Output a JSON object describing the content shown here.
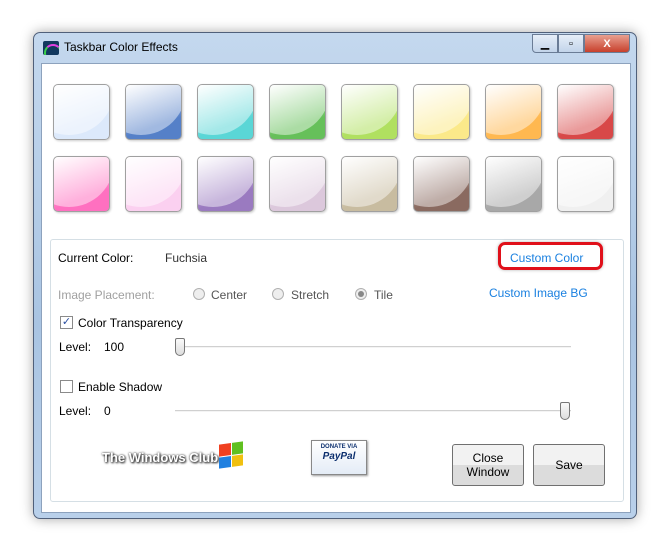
{
  "window": {
    "title": "Taskbar Color Effects",
    "close_glyph": "X"
  },
  "swatches": [
    {
      "name": "light-blue",
      "color": "#dce9fb"
    },
    {
      "name": "blue",
      "color": "#5580c8"
    },
    {
      "name": "cyan",
      "color": "#5ad6d6"
    },
    {
      "name": "green",
      "color": "#66c05a"
    },
    {
      "name": "lime",
      "color": "#b0e060"
    },
    {
      "name": "yellow",
      "color": "#fbe98a"
    },
    {
      "name": "orange",
      "color": "#ffb850"
    },
    {
      "name": "red",
      "color": "#d84848"
    },
    {
      "name": "fuchsia",
      "color": "#ff70c0"
    },
    {
      "name": "light-pink",
      "color": "#fbd0f0"
    },
    {
      "name": "purple",
      "color": "#9a7ac0"
    },
    {
      "name": "mauve",
      "color": "#dcc8dc"
    },
    {
      "name": "taupe",
      "color": "#c8bca0"
    },
    {
      "name": "brown",
      "color": "#8a6a60"
    },
    {
      "name": "gray",
      "color": "#a8a8a8"
    },
    {
      "name": "white",
      "color": "#f0f0f0"
    }
  ],
  "settings": {
    "current_color_label": "Current Color:",
    "current_color_value": "Fuchsia",
    "custom_color": "Custom Color",
    "custom_image_bg": "Custom Image BG",
    "image_placement_label": "Image Placement:",
    "placement_options": [
      "Center",
      "Stretch",
      "Tile"
    ],
    "placement_selected": "Tile",
    "color_transparency_label": "Color Transparency",
    "color_transparency_checked": true,
    "transparency_level_label": "Level:",
    "transparency_level": "100",
    "enable_shadow_label": "Enable Shadow",
    "enable_shadow_checked": false,
    "shadow_level_label": "Level:",
    "shadow_level": "0"
  },
  "footer": {
    "logo_text": "The Windows Club",
    "paypal_top": "DONATE VIA",
    "paypal_brand": "PayPal",
    "close_window": "Close Window",
    "save": "Save"
  }
}
